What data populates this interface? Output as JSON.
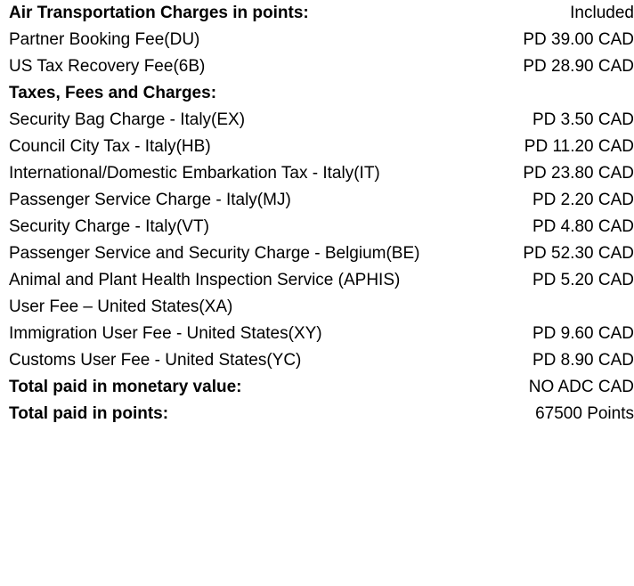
{
  "document": {
    "title": "Air Transportation Charges Breakdown",
    "currency": "CAD",
    "points_unit": "Points"
  },
  "rows": [
    {
      "label": "Air Transportation Charges in points:",
      "value": "Included",
      "style": "header"
    },
    {
      "label": "Partner Booking Fee(DU)",
      "value": "PD 39.00 CAD",
      "style": "item"
    },
    {
      "label": "US Tax Recovery Fee(6B)",
      "value": "PD 28.90 CAD",
      "style": "item"
    },
    {
      "label": "Taxes, Fees and Charges:",
      "value": "",
      "style": "header"
    },
    {
      "label": "Security Bag Charge - Italy(EX)",
      "value": "PD 3.50 CAD",
      "style": "item"
    },
    {
      "label": "Council City Tax - Italy(HB)",
      "value": "PD 11.20 CAD",
      "style": "item"
    },
    {
      "label": "International/Domestic Embarkation Tax - Italy(IT)",
      "value": "PD 23.80 CAD",
      "style": "item"
    },
    {
      "label": "Passenger Service Charge - Italy(MJ)",
      "value": "PD 2.20 CAD",
      "style": "item"
    },
    {
      "label": "Security Charge - Italy(VT)",
      "value": "PD 4.80 CAD",
      "style": "item"
    },
    {
      "label": "Passenger Service and Security Charge - Belgium(BE)",
      "value": "PD 52.30 CAD",
      "style": "item"
    },
    {
      "label": "Animal and Plant Health Inspection Service (APHIS) User Fee – United States(XA)",
      "value": "PD 5.20 CAD",
      "style": "item"
    },
    {
      "label": "Immigration User Fee - United States(XY)",
      "value": "PD 9.60 CAD",
      "style": "item"
    },
    {
      "label": "Customs User Fee - United States(YC)",
      "value": "PD 8.90 CAD",
      "style": "item"
    },
    {
      "label": "Total paid in monetary value:",
      "value": "NO ADC CAD",
      "style": "total"
    },
    {
      "label": "Total paid in points:",
      "value": "67500 Points",
      "style": "total"
    }
  ],
  "colors": {
    "text": "#000000",
    "background": "#ffffff"
  }
}
